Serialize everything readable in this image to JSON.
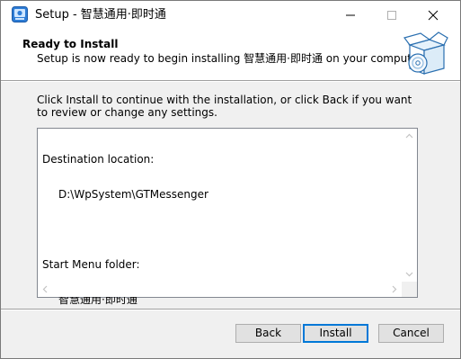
{
  "window": {
    "title": "Setup - 智慧通用·即时通",
    "icons": {
      "app": "setup-app-icon",
      "minimize": "minimize-icon",
      "maximize": "maximize-icon",
      "close": "close-icon"
    }
  },
  "header": {
    "title": "Ready to Install",
    "subtitle": "Setup is now ready to begin installing 智慧通用·即时通 on your computer.",
    "icon": "install-box-disc-icon"
  },
  "body": {
    "intro": "Click Install to continue with the installation, or click Back if you want to review or change any settings.",
    "memo": {
      "destination_label": "Destination location:",
      "destination_value": "D:\\WpSystem\\GTMessenger",
      "start_menu_label": "Start Menu folder:",
      "start_menu_value": "智慧通用·即时通"
    }
  },
  "buttons": {
    "back": "Back",
    "install": "Install",
    "cancel": "Cancel"
  },
  "colors": {
    "accent": "#0078d7",
    "dialog_background": "#f0f0f0",
    "button_face": "#e1e1e1"
  }
}
